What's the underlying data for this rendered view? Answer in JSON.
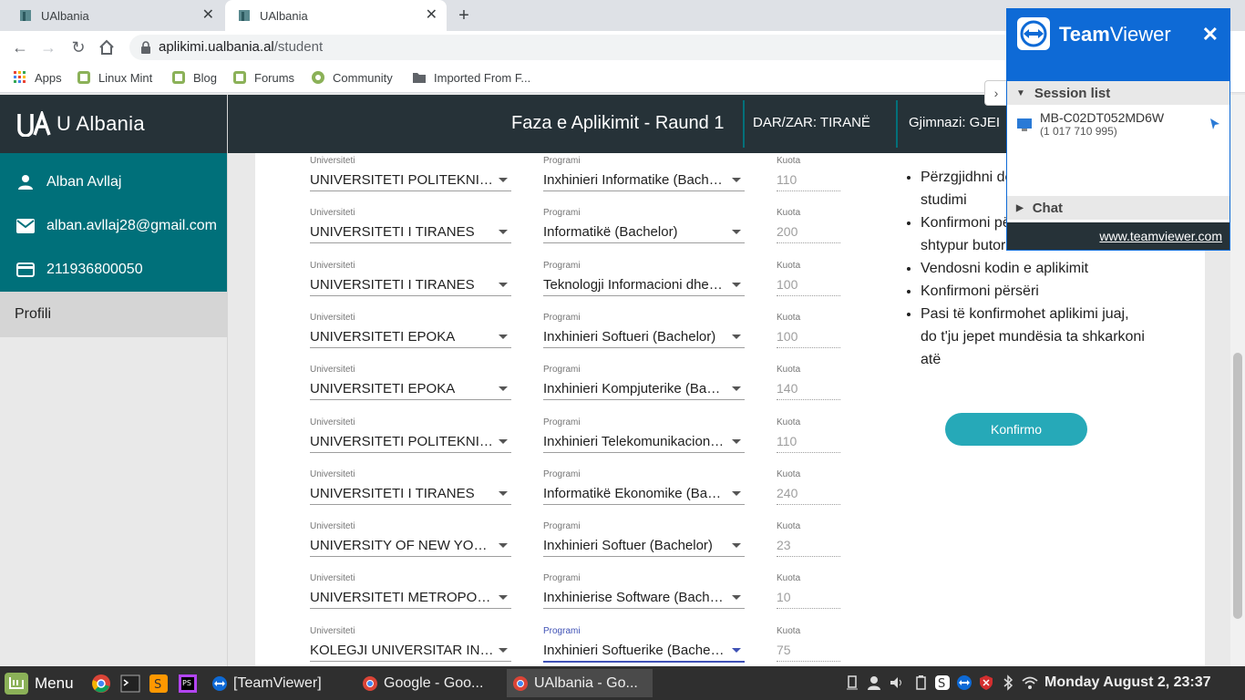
{
  "browser": {
    "tabs": [
      {
        "title": "UAlbania",
        "active": false
      },
      {
        "title": "UAlbania",
        "active": true
      }
    ],
    "url_host": "aplikimi.ualbania.al",
    "url_path": "/student",
    "bookmarks": [
      "Apps",
      "Linux Mint",
      "Blog",
      "Forums",
      "Community",
      "Imported From F..."
    ]
  },
  "app": {
    "logo_text": "U Albania",
    "user": {
      "name": "Alban Avllaj",
      "email": "alban.avllaj28@gmail.com",
      "id": "211936800050"
    },
    "menu": [
      "Profili"
    ],
    "header": {
      "phase": "Faza e Aplikimit - Raund 1",
      "dar_zar": "DAR/ZAR: TIRANË",
      "gjimnazi": "Gjimnazi: GJEI"
    },
    "labels": {
      "university": "Universiteti",
      "program": "Programi",
      "quota": "Kuota"
    },
    "rows": [
      {
        "university": "UNIVERSITETI POLITEKNIK I TIRANËS",
        "program": "Inxhinieri Informatike (Bachelor)",
        "quota": "110"
      },
      {
        "university": "UNIVERSITETI I TIRANES",
        "program": "Informatikë (Bachelor)",
        "quota": "200"
      },
      {
        "university": "UNIVERSITETI I TIRANES",
        "program": "Teknologji Informacioni dhe Komunikimi (Bachelor)",
        "quota": "100"
      },
      {
        "university": "UNIVERSITETI EPOKA",
        "program": "Inxhinieri Softueri (Bachelor)",
        "quota": "100"
      },
      {
        "university": "UNIVERSITETI EPOKA",
        "program": "Inxhinieri Kompjuterike (Bachelor)",
        "quota": "140"
      },
      {
        "university": "UNIVERSITETI POLITEKNIK I TIRANËS",
        "program": "Inxhinieri Telekomunikacioni (Bachelor)",
        "quota": "110"
      },
      {
        "university": "UNIVERSITETI I TIRANES",
        "program": "Informatikë Ekonomike (Bachelor)",
        "quota": "240"
      },
      {
        "university": "UNIVERSITY OF NEW YORK TIRANA",
        "program": "Inxhinieri Softuer (Bachelor)",
        "quota": "23"
      },
      {
        "university": "UNIVERSITETI METROPOLITAN TIRANA",
        "program": "Inxhinierise Software (Bachelor)",
        "quota": "10"
      },
      {
        "university": "KOLEGJI UNIVERSITAR INSTITUTI",
        "program": "Inxhinieri Softuerike (Bachelor)",
        "quota": "75"
      }
    ],
    "instructions": [
      "Përzgjidhni de...",
      "studimi",
      "Konfirmoni pë...",
      "shtypur butor...",
      "Vendosni kodin e aplikimit",
      "Konfirmoni përsëri",
      "Pasi të konfirmohet aplikimi juaj,",
      "do t'ju jepet mundësia ta shkarkoni",
      "atë"
    ],
    "confirm_label": "Konfirmo"
  },
  "teamviewer": {
    "brand_bold": "Team",
    "brand_rest": "Viewer",
    "session_list_label": "Session list",
    "session_name": "MB-C02DT052MD6W",
    "session_id": "(1 017 710 995)",
    "chat_label": "Chat",
    "link": "www.teamviewer.com"
  },
  "taskbar": {
    "menu_label": "Menu",
    "windows": [
      {
        "title": "[TeamViewer]",
        "active": false
      },
      {
        "title": "Google - Goo...",
        "active": false
      },
      {
        "title": "UAlbania - Go...",
        "active": true
      }
    ],
    "clock": "Monday August  2, 23:37"
  },
  "colors": {
    "teal": "#00707a",
    "dark": "#263238",
    "button": "#26a9b8",
    "teamviewer_blue": "#0e6ad6"
  }
}
